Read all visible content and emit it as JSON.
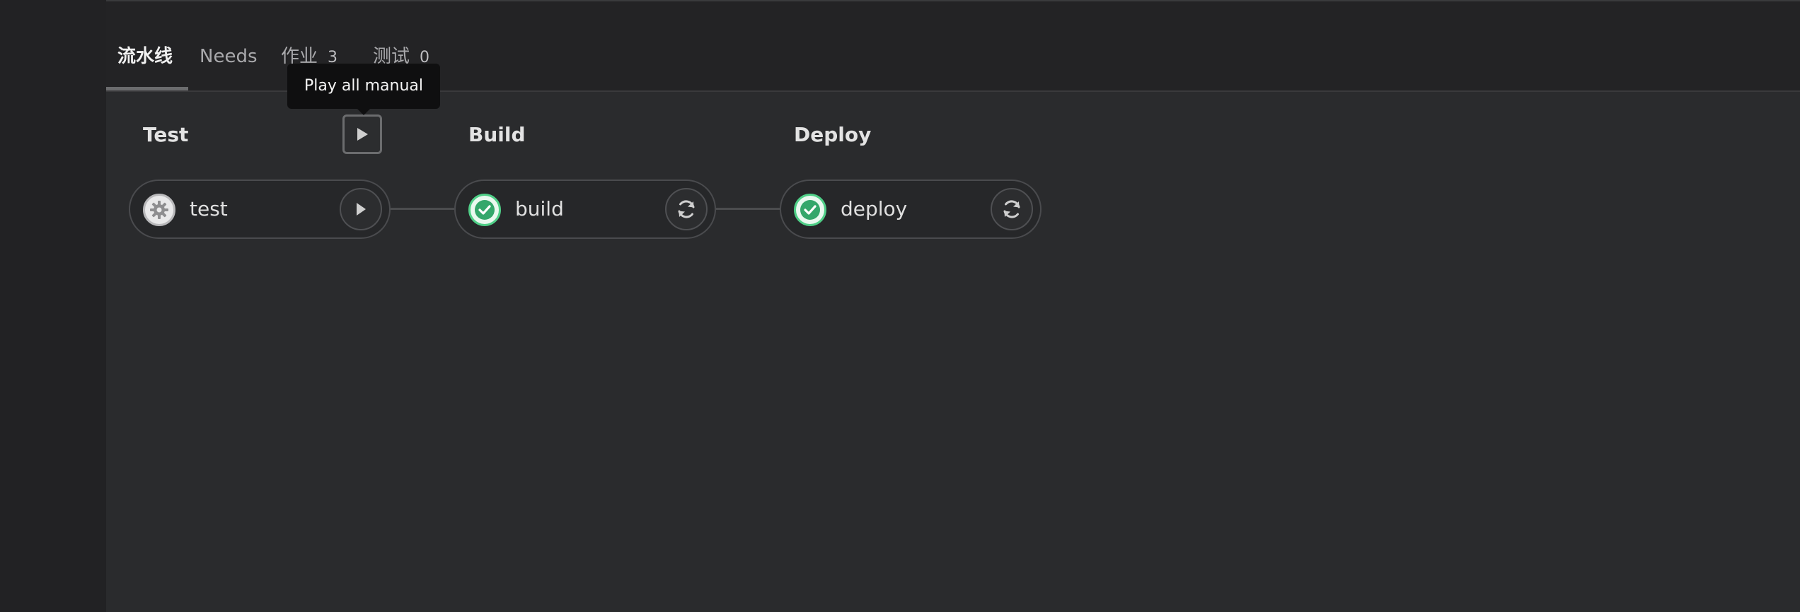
{
  "tabs": {
    "pipeline": {
      "label": "流水线"
    },
    "needs": {
      "label": "Needs"
    },
    "jobs": {
      "label": "作业",
      "count": "3"
    },
    "tests": {
      "label": "测试",
      "count": "0"
    }
  },
  "tooltip": {
    "text": "Play all manual"
  },
  "stages": {
    "test": {
      "title": "Test",
      "jobs": [
        {
          "name": "test",
          "status": "manual",
          "status_icon": "gear-icon",
          "action_icon": "play-icon"
        }
      ]
    },
    "build": {
      "title": "Build",
      "jobs": [
        {
          "name": "build",
          "status": "success",
          "status_icon": "check-icon",
          "action_icon": "retry-icon"
        }
      ]
    },
    "deploy": {
      "title": "Deploy",
      "jobs": [
        {
          "name": "deploy",
          "status": "success",
          "status_icon": "check-icon",
          "action_icon": "retry-icon"
        }
      ]
    }
  },
  "colors": {
    "background": "#2a2b2d",
    "tab_bar": "#232325",
    "success": "#4fcf87",
    "manual": "#b9b9bb",
    "tooltip": "#0f0f10"
  }
}
